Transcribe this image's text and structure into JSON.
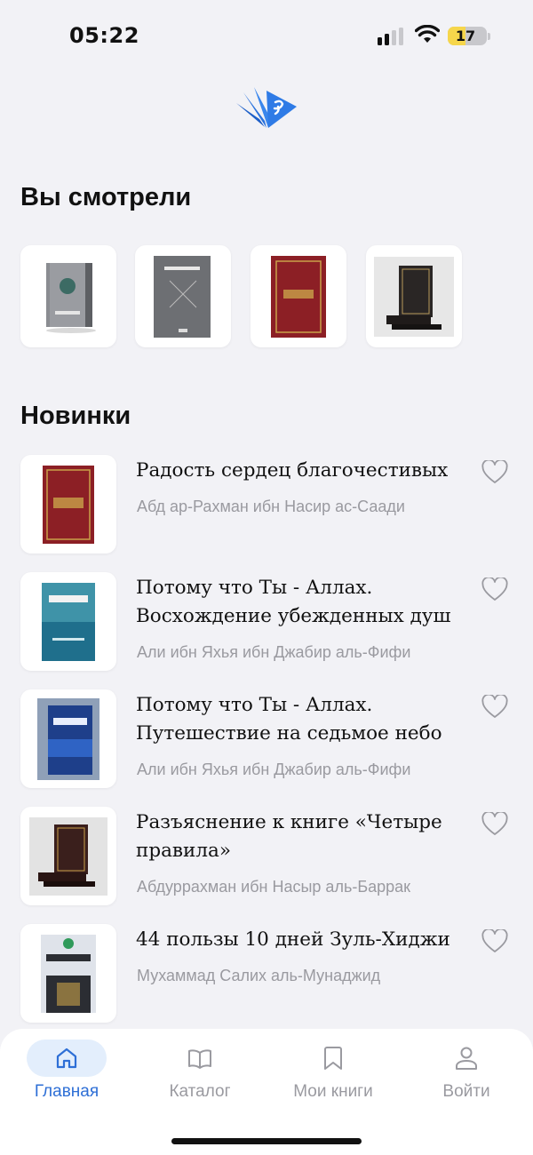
{
  "status_bar": {
    "time": "05:22",
    "battery_level": "17",
    "battery_fraction": 0.17,
    "battery_color": "#f6d64b"
  },
  "sections": {
    "viewed_title": "Вы смотрели",
    "new_title": "Новинки"
  },
  "viewed_books": [
    {
      "name": "viewed-book-1",
      "cover_color": "#7d7f84"
    },
    {
      "name": "viewed-book-2",
      "cover_color": "#6d6f73"
    },
    {
      "name": "viewed-book-3",
      "cover_color": "#8c1f25"
    },
    {
      "name": "viewed-book-4",
      "cover_color": "#2a2625"
    }
  ],
  "new_books": [
    {
      "title": "Радость сердец благочестивых",
      "author": "Абд ар-Рахман ибн Насир ас-Саади",
      "cover_color": "#8c1f25"
    },
    {
      "title": "Потому что Ты - Аллах. Восхождение убежденных душ",
      "author": "Али ибн Яхья ибн Джабир аль-Фифи",
      "cover_color": "#1f6f8c"
    },
    {
      "title": "Потому что Ты - Аллах. Путешествие на седьмое небо",
      "author": "Али ибн Яхья ибн Джабир аль-Фифи",
      "cover_color": "#1e3f8a"
    },
    {
      "title": "Разъяснение к книге «Четыре правила»",
      "author": "Абдуррахман ибн Насыр аль-Баррак",
      "cover_color": "#3a1f1c"
    },
    {
      "title": "44 пользы 10 дней Зуль-Хиджи",
      "author": "Мухаммад Салих аль-Мунаджид",
      "cover_color": "#2b2d33"
    }
  ],
  "tabs": [
    {
      "label": "Главная",
      "icon": "home-icon",
      "active": true
    },
    {
      "label": "Каталог",
      "icon": "book-open-icon",
      "active": false
    },
    {
      "label": "Мои книги",
      "icon": "bookmark-icon",
      "active": false
    },
    {
      "label": "Войти",
      "icon": "user-icon",
      "active": false
    }
  ],
  "colors": {
    "accent": "#2e6fd6",
    "background": "#f2f2f6",
    "muted_text": "#9a9aa0"
  }
}
